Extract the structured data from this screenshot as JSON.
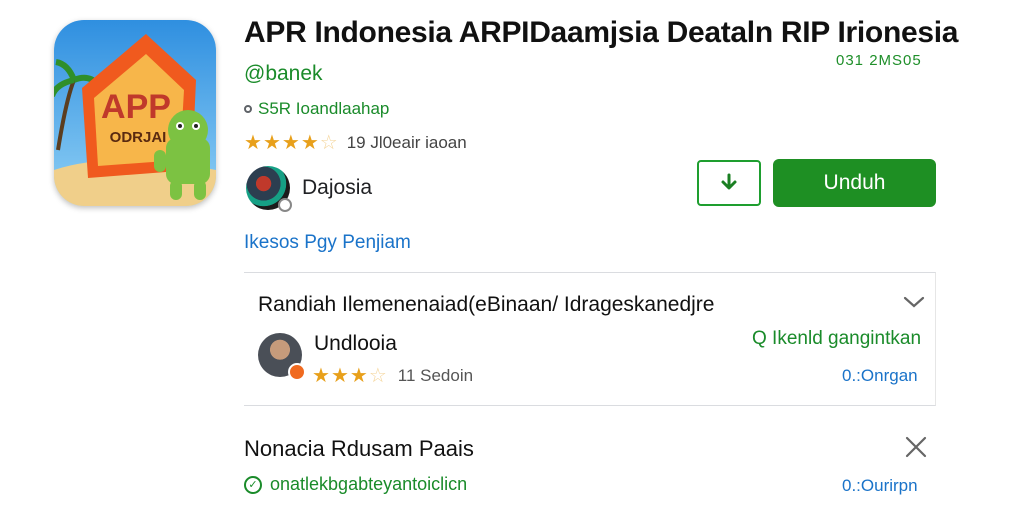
{
  "app": {
    "title": "APR Indonesia ARPIDaamjsia Deataln RIP Irionesia",
    "icon_text_main": "APP",
    "icon_text_sub": "ODRJAI",
    "code": "031 2MS05",
    "developer": "@banek",
    "meta": "S5R Ioandlaahap",
    "rating_stars": 4.5,
    "rating_text": "19 Jl0eair iaoan",
    "publisher_name": "Dajosia",
    "install_label": "Unduh",
    "link_text": "Ikesos Pgy Penjiam"
  },
  "review_card": {
    "title": "Randiah Ilemenenaiad(eBinaan/ Idrageskanedjre",
    "reviewer_name": "Undlooia",
    "rating_stars": 3.5,
    "rating_text": "11 Sedoin",
    "action_text": "Q Ikenld gangintkan",
    "meta_text": "0.:Onrgan"
  },
  "section2": {
    "title": "Nonacia Rdusam Paais",
    "line": "onatlekbgabteyantoiclicn",
    "meta_text": "0.:Ourirpn"
  },
  "colors": {
    "accent_green": "#1e8f23",
    "link_blue": "#1a73c9",
    "star": "#e8a01b"
  },
  "icons": [
    "download-icon",
    "chevron-down-icon",
    "close-icon",
    "check-circle-icon",
    "star-icon"
  ]
}
